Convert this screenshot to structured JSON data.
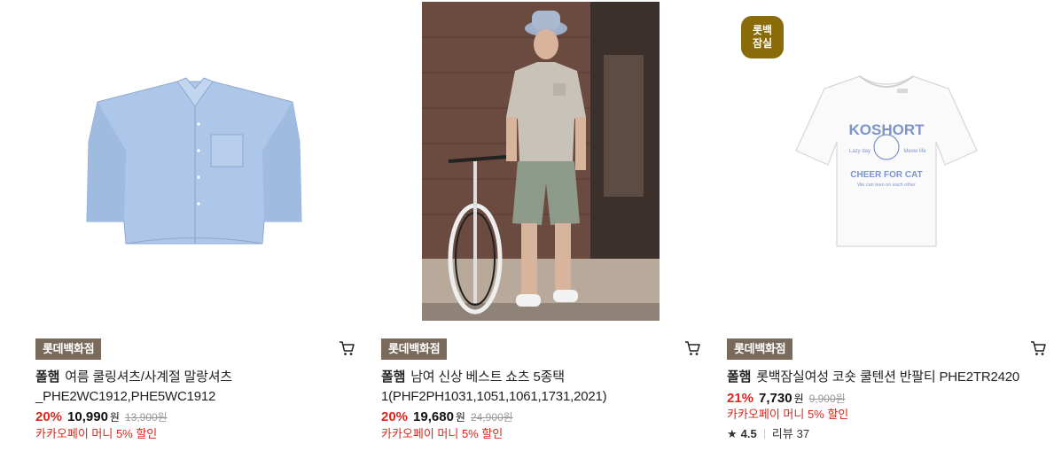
{
  "products": [
    {
      "store_badge": "롯데백화점",
      "brand": "폴햄",
      "name": "여름 쿨링셔츠/사계절 말랑셔츠 _PHE2WC1912,PHE5WC1912",
      "discount": "20%",
      "price": "10,990",
      "currency": "원",
      "original_price": "13,900원",
      "promo": "카카오페이 머니 5% 할인",
      "image_icon": "shirt-image"
    },
    {
      "store_badge": "롯데백화점",
      "brand": "폴햄",
      "name": "남여 신상 베스트 쇼츠 5종택1(PHF2PH1031,1051,1061,1731,2021)",
      "discount": "20%",
      "price": "19,680",
      "currency": "원",
      "original_price": "24,900원",
      "promo": "카카오페이 머니 5% 할인",
      "image_icon": "model-with-bicycle-photo"
    },
    {
      "store_badge": "롯데백화점",
      "brand": "폴햄",
      "name": "롯백잠실여성 코숏 쿨텐션 반팔티 PHE2TR2420",
      "discount": "21%",
      "price": "7,730",
      "currency": "원",
      "original_price": "9,900원",
      "promo": "카카오페이 머니 5% 할인",
      "corner_badge_line1": "롯백",
      "corner_badge_line2": "잠실",
      "rating": "4.5",
      "review_label": "리뷰",
      "review_count": "37",
      "tshirt_print": {
        "line1": "KOSHORT",
        "line2_left": "Lazy day",
        "line2_right": "Meow life",
        "line3": "CHEER FOR CAT",
        "line4": "We can lean on each other"
      },
      "image_icon": "tshirt-image"
    }
  ],
  "colors": {
    "discount_red": "#e1251b",
    "store_badge_bg": "#7a6a5c",
    "corner_badge_bg": "#8a6b0a",
    "shirt_blue": "#a9c3e6"
  },
  "icons": {
    "cart": "shopping-cart-icon",
    "star": "star-icon"
  },
  "star_glyph": "★"
}
